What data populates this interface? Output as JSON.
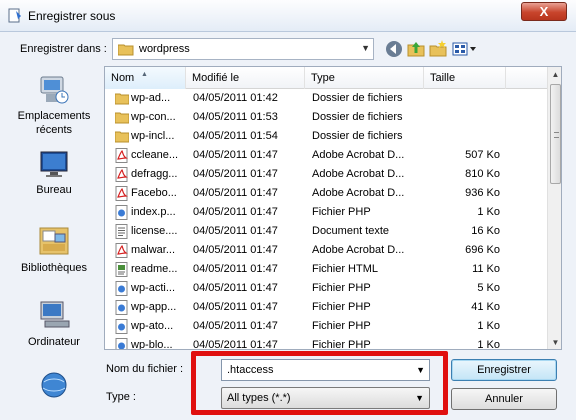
{
  "window": {
    "title": "Enregistrer sous",
    "close_label": "X"
  },
  "toolbar": {
    "save_in_label": "Enregistrer dans :",
    "location": "wordpress",
    "buttons": [
      "back-icon",
      "up-folder-icon",
      "new-folder-icon",
      "view-menu-icon"
    ]
  },
  "places": [
    {
      "label": "Emplacements récents",
      "icon": "recent-places-icon"
    },
    {
      "label": "Bureau",
      "icon": "desktop-icon"
    },
    {
      "label": "Bibliothèques",
      "icon": "libraries-icon"
    },
    {
      "label": "Ordinateur",
      "icon": "computer-icon"
    },
    {
      "label": "",
      "icon": "network-icon"
    }
  ],
  "columns": {
    "name": "Nom",
    "date": "Modifié le",
    "type": "Type",
    "size": "Taille"
  },
  "files": [
    {
      "name": "wp-ad...",
      "date": "04/05/2011 01:42",
      "type": "Dossier de fichiers",
      "size": "",
      "icon": "folder"
    },
    {
      "name": "wp-con...",
      "date": "04/05/2011 01:53",
      "type": "Dossier de fichiers",
      "size": "",
      "icon": "folder"
    },
    {
      "name": "wp-incl...",
      "date": "04/05/2011 01:54",
      "type": "Dossier de fichiers",
      "size": "",
      "icon": "folder"
    },
    {
      "name": "ccleane...",
      "date": "04/05/2011 01:47",
      "type": "Adobe Acrobat D...",
      "size": "507 Ko",
      "icon": "pdf"
    },
    {
      "name": "defragg...",
      "date": "04/05/2011 01:47",
      "type": "Adobe Acrobat D...",
      "size": "810 Ko",
      "icon": "pdf"
    },
    {
      "name": "Facebo...",
      "date": "04/05/2011 01:47",
      "type": "Adobe Acrobat D...",
      "size": "936 Ko",
      "icon": "pdf"
    },
    {
      "name": "index.p...",
      "date": "04/05/2011 01:47",
      "type": "Fichier PHP",
      "size": "1 Ko",
      "icon": "php"
    },
    {
      "name": "license....",
      "date": "04/05/2011 01:47",
      "type": "Document texte",
      "size": "16 Ko",
      "icon": "text"
    },
    {
      "name": "malwar...",
      "date": "04/05/2011 01:47",
      "type": "Adobe Acrobat D...",
      "size": "696 Ko",
      "icon": "pdf"
    },
    {
      "name": "readme...",
      "date": "04/05/2011 01:47",
      "type": "Fichier HTML",
      "size": "11 Ko",
      "icon": "html"
    },
    {
      "name": "wp-acti...",
      "date": "04/05/2011 01:47",
      "type": "Fichier PHP",
      "size": "5 Ko",
      "icon": "php"
    },
    {
      "name": "wp-app...",
      "date": "04/05/2011 01:47",
      "type": "Fichier PHP",
      "size": "41 Ko",
      "icon": "php"
    },
    {
      "name": "wp-ato...",
      "date": "04/05/2011 01:47",
      "type": "Fichier PHP",
      "size": "1 Ko",
      "icon": "php"
    },
    {
      "name": "wp-blo...",
      "date": "04/05/2011 01:47",
      "type": "Fichier PHP",
      "size": "1 Ko",
      "icon": "php"
    }
  ],
  "form": {
    "filename_label": "Nom du fichier :",
    "filename_value": ".htaccess",
    "type_label": "Type :",
    "type_value": "All types (*.*)"
  },
  "actions": {
    "save": "Enregistrer",
    "cancel": "Annuler"
  },
  "colors": {
    "highlight": "#e0100f",
    "title_bar": "#e4ecf6",
    "close_button": "#c8452c"
  }
}
